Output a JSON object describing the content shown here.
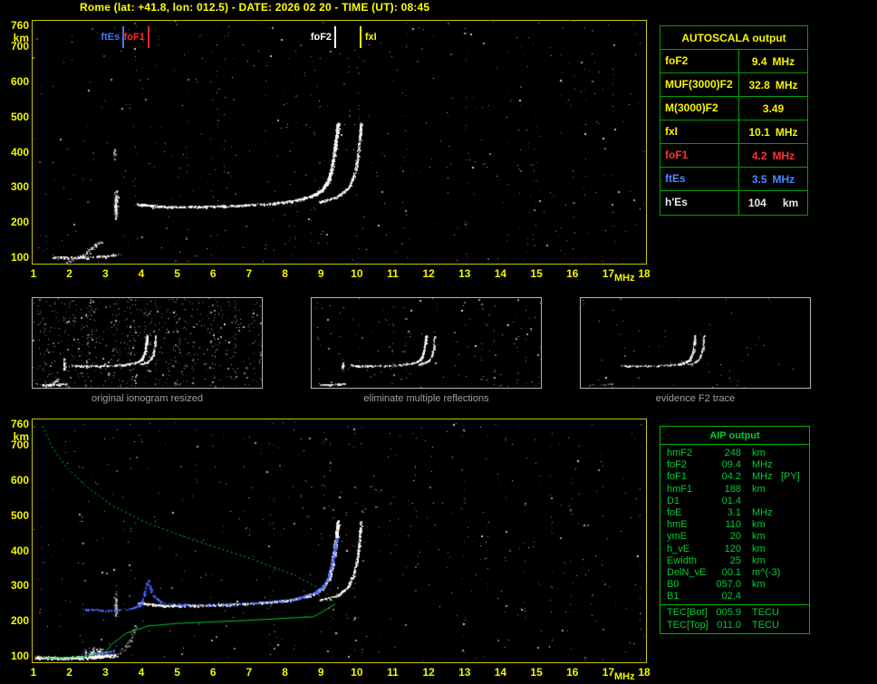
{
  "title": "Rome (lat: +41.8, lon: 012.5) - DATE: 2026 02 20 - TIME (UT): 08:45",
  "axes": {
    "y_ticks": [
      760,
      700,
      600,
      500,
      400,
      300,
      200,
      100
    ],
    "y_unit": "km",
    "x_ticks": [
      1,
      2,
      3,
      4,
      5,
      6,
      7,
      8,
      9,
      10,
      11,
      12,
      13,
      14,
      15,
      16,
      17,
      18
    ],
    "x_unit": "MHz"
  },
  "top_plot": {
    "markers": [
      {
        "label": "ftEs",
        "freq": 3.5,
        "color": "#3a7bff",
        "side": "left"
      },
      {
        "label": "foF1",
        "freq": 4.2,
        "color": "#ff2a2a",
        "side": "left"
      },
      {
        "label": "foF2",
        "freq": 9.4,
        "color": "#ffffff",
        "side": "left"
      },
      {
        "label": "fxI",
        "freq": 10.1,
        "color": "#f5f500",
        "side": "right"
      }
    ]
  },
  "autoscala": {
    "title": "AUTOSCALA output",
    "rows": [
      {
        "name": "foF2",
        "value": "9.4",
        "unit": "MHz",
        "color": "#f5f500"
      },
      {
        "name": "MUF(3000)F2",
        "value": "32.8",
        "unit": "MHz",
        "color": "#f5f500"
      },
      {
        "name": "M(3000)F2",
        "value": "3.49",
        "unit": "",
        "color": "#f5f500"
      },
      {
        "name": "fxI",
        "value": "10.1",
        "unit": "MHz",
        "color": "#f5f500"
      },
      {
        "name": "foF1",
        "value": "4.2",
        "unit": "MHz",
        "color": "#ff3030"
      },
      {
        "name": "ftEs",
        "value": "3.5",
        "unit": "MHz",
        "color": "#4a86ff"
      },
      {
        "name": "h'Es",
        "value": "104",
        "unit": "km",
        "color": "#e8e8e8",
        "wide": true
      }
    ]
  },
  "thumbnails": [
    {
      "caption": "original ionogram resized"
    },
    {
      "caption": "eliminate multiple reflections"
    },
    {
      "caption": "evidence F2 trace"
    }
  ],
  "aip": {
    "title": "AIP output",
    "rows": [
      {
        "name": "hmF2",
        "value": "248",
        "unit": "km",
        "extra": ""
      },
      {
        "name": "foF2",
        "value": "09.4",
        "unit": "MHz",
        "extra": ""
      },
      {
        "name": "foF1",
        "value": "04.2",
        "unit": "MHz",
        "extra": "[PY]"
      },
      {
        "name": "hmF1",
        "value": "188",
        "unit": "km",
        "extra": ""
      },
      {
        "name": "D1",
        "value": "01.4",
        "unit": "",
        "extra": ""
      },
      {
        "name": "foE",
        "value": "3.1",
        "unit": "MHz",
        "extra": ""
      },
      {
        "name": "hmE",
        "value": "110",
        "unit": "km",
        "extra": ""
      },
      {
        "name": "ymE",
        "value": "20",
        "unit": "km",
        "extra": ""
      },
      {
        "name": "h_vE",
        "value": "120",
        "unit": "km",
        "extra": ""
      },
      {
        "name": "Ewidth",
        "value": "25",
        "unit": "km",
        "extra": ""
      },
      {
        "name": "DelN_vE",
        "value": "00.1",
        "unit": "m^(-3)",
        "extra": ""
      },
      {
        "name": "B0",
        "value": "057.0",
        "unit": "km",
        "extra": ""
      },
      {
        "name": "B1",
        "value": "02.4",
        "unit": "",
        "extra": ""
      }
    ],
    "tec_rows": [
      {
        "name": "TEC[Bot]",
        "value": "005.9",
        "unit": "TECU",
        "extra": ""
      },
      {
        "name": "TEC[Top]",
        "value": "011.0",
        "unit": "TECU",
        "extra": ""
      }
    ]
  },
  "chart_data": {
    "type": "scatter",
    "description": "Vertical-incidence ionograms: virtual height (km) vs sounding frequency (MHz). Top: recorded ionogram with AUTOSCALA scaled frequencies marked. Bottom: restored ionogram with fitted trace (blue) and electron-density profile (green).",
    "x_range": [
      1,
      18
    ],
    "y_range": [
      100,
      760
    ],
    "scaled_parameters": {
      "foF2_MHz": 9.4,
      "MUF3000F2_MHz": 32.8,
      "M3000F2": 3.49,
      "fxI_MHz": 10.1,
      "foF1_MHz": 4.2,
      "ftEs_MHz": 3.5,
      "hEs_km": 104,
      "hmF2_km": 248,
      "hmF1_km": 188,
      "foE_MHz": 3.1,
      "hmE_km": 110,
      "B0_km": 57.0,
      "B1": 2.4,
      "TEC_bot_TECU": 5.9,
      "TEC_top_TECU": 11.0
    },
    "traces": {
      "es_layer": [
        [
          1.55,
          104
        ],
        [
          2.2,
          102
        ],
        [
          2.9,
          105
        ],
        [
          3.35,
          111
        ]
      ],
      "es_oblique": [
        [
          1.95,
          93
        ],
        [
          2.4,
          108
        ],
        [
          2.85,
          148
        ]
      ],
      "e_band": [
        [
          1.05,
          99
        ],
        [
          1.8,
          97
        ],
        [
          2.6,
          100
        ],
        [
          3.3,
          106
        ]
      ],
      "ef_connector": [
        [
          3.35,
          108
        ],
        [
          3.65,
          140
        ],
        [
          3.85,
          190
        ]
      ],
      "f_ordinary": [
        [
          3.9,
          254
        ],
        [
          4.6,
          247
        ],
        [
          5.6,
          247
        ],
        [
          6.6,
          250
        ],
        [
          7.6,
          256
        ],
        [
          8.3,
          265
        ],
        [
          8.8,
          280
        ],
        [
          9.05,
          297
        ],
        [
          9.2,
          322
        ],
        [
          9.3,
          358
        ],
        [
          9.37,
          402
        ],
        [
          9.43,
          448
        ],
        [
          9.47,
          487
        ]
      ],
      "f_extraordinary": [
        [
          8.95,
          261
        ],
        [
          9.45,
          275
        ],
        [
          9.75,
          299
        ],
        [
          9.92,
          338
        ],
        [
          10.02,
          386
        ],
        [
          10.07,
          436
        ],
        [
          10.11,
          485
        ]
      ],
      "profile_green": [
        [
          1.25,
          757
        ],
        [
          1.5,
          700
        ],
        [
          1.9,
          641
        ],
        [
          2.5,
          582
        ],
        [
          3.2,
          530
        ],
        [
          4.2,
          479
        ],
        [
          5.5,
          431
        ],
        [
          7.0,
          381
        ],
        [
          8.3,
          331
        ],
        [
          9.1,
          286
        ],
        [
          9.4,
          250
        ],
        [
          8.8,
          214
        ],
        [
          7.0,
          204
        ],
        [
          5.0,
          195
        ],
        [
          4.2,
          188
        ],
        [
          3.6,
          168
        ],
        [
          3.2,
          138
        ],
        [
          3.0,
          113
        ],
        [
          2.4,
          100
        ],
        [
          1.3,
          95
        ]
      ],
      "fitted_blue": [
        [
          2.3,
          236
        ],
        [
          3.1,
          233
        ],
        [
          3.7,
          237
        ],
        [
          4.0,
          252
        ],
        [
          4.18,
          320
        ],
        [
          4.3,
          278
        ],
        [
          4.55,
          254
        ],
        [
          5.5,
          248
        ],
        [
          6.5,
          251
        ],
        [
          7.5,
          257
        ],
        [
          8.3,
          266
        ],
        [
          8.8,
          282
        ],
        [
          9.05,
          300
        ],
        [
          9.2,
          328
        ],
        [
          9.3,
          362
        ],
        [
          9.38,
          405
        ],
        [
          9.43,
          440
        ]
      ],
      "fitted_blue_e": [
        [
          2.4,
          110
        ],
        [
          3.0,
          112
        ],
        [
          3.3,
          118
        ]
      ]
    }
  }
}
